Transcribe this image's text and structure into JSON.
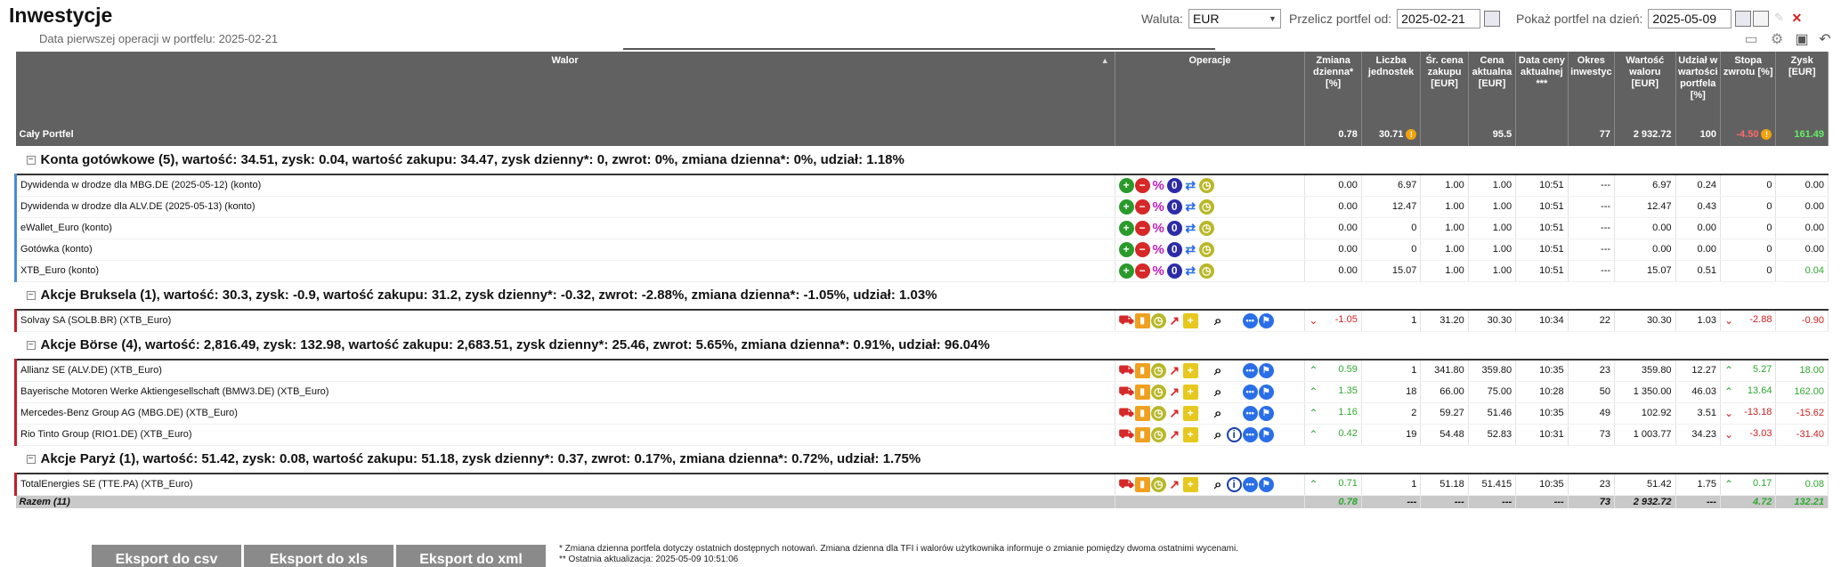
{
  "title": "Inwestycje",
  "subtitle": "Data pierwszej operacji w portfelu: 2025-02-21",
  "controls": {
    "currency_label": "Waluta:",
    "currency_value": "EUR",
    "recalc_label": "Przelicz portfel od:",
    "recalc_date": "2025-02-21",
    "show_label": "Pokaż portfel na dzień:",
    "show_date": "2025-05-09"
  },
  "table": {
    "headers": [
      "Walor",
      "Operacje",
      "Zmiana dzienna* [%]",
      "Liczba jednostek",
      "Śr. cena zakupu [EUR]",
      "Cena aktualna [EUR]",
      "Data ceny aktualnej ***",
      "Okres inwestyc",
      "Wartość waloru [EUR]",
      "Udział w wartości portfela [%]",
      "Stopa zwrotu [%]",
      "Zysk [EUR]"
    ],
    "total": {
      "name": "Cały Portfel",
      "change": "0.78",
      "units": "30.71",
      "avg": "",
      "price": "95.5",
      "date": "",
      "period": "77",
      "value": "2 932.72",
      "share": "100",
      "ret": "-4.50",
      "profit": "161.49"
    },
    "groups": [
      {
        "title": "Konta gotówkowe (5), wartość: 34.51, zysk: 0.04, wartość zakupu: 34.47, zysk dzienny*: 0, zwrot: 0%, zmiana dzienna*: 0%, udział: 1.18%",
        "kind": "cash",
        "rows": [
          {
            "name": "Dywidenda w drodze dla MBG.DE (2025-05-12) (konto)",
            "change": "0.00",
            "units": "6.97",
            "avg": "1.00",
            "price": "1.00",
            "date": "10:51",
            "period": "---",
            "value": "6.97",
            "share": "0.24",
            "ret": "0",
            "profit": "0.00"
          },
          {
            "name": "Dywidenda w drodze dla ALV.DE (2025-05-13) (konto)",
            "change": "0.00",
            "units": "12.47",
            "avg": "1.00",
            "price": "1.00",
            "date": "10:51",
            "period": "---",
            "value": "12.47",
            "share": "0.43",
            "ret": "0",
            "profit": "0.00"
          },
          {
            "name": "eWallet_Euro (konto)",
            "change": "0.00",
            "units": "0",
            "avg": "1.00",
            "price": "1.00",
            "date": "10:51",
            "period": "---",
            "value": "0.00",
            "share": "0.00",
            "ret": "0",
            "profit": "0.00"
          },
          {
            "name": "Gotówka (konto)",
            "change": "0.00",
            "units": "0",
            "avg": "1.00",
            "price": "1.00",
            "date": "10:51",
            "period": "---",
            "value": "0.00",
            "share": "0.00",
            "ret": "0",
            "profit": "0.00"
          },
          {
            "name": "XTB_Euro (konto)",
            "change": "0.00",
            "units": "15.07",
            "avg": "1.00",
            "price": "1.00",
            "date": "10:51",
            "period": "---",
            "value": "15.07",
            "share": "0.51",
            "ret": "0",
            "profit": "0.04"
          }
        ]
      },
      {
        "title": "Akcje Bruksela (1), wartość: 30.3, zysk: -0.9, wartość zakupu: 31.2, zysk dzienny*: -0.32, zwrot: -2.88%, zmiana dzienna*: -1.05%, udział: 1.03%",
        "kind": "stock",
        "rows": [
          {
            "name": "Solvay SA (SOLB.BR) (XTB_Euro)",
            "change": "-1.05",
            "units": "1",
            "avg": "31.20",
            "price": "30.30",
            "date": "10:34",
            "period": "22",
            "value": "30.30",
            "share": "1.03",
            "ret": "-2.88",
            "profit": "-0.90",
            "info": false
          }
        ]
      },
      {
        "title": "Akcje Börse (4), wartość: 2,816.49, zysk: 132.98, wartość zakupu: 2,683.51, zysk dzienny*: 25.46, zwrot: 5.65%, zmiana dzienna*: 0.91%, udział: 96.04%",
        "kind": "stock",
        "rows": [
          {
            "name": "Allianz SE (ALV.DE) (XTB_Euro)",
            "change": "0.59",
            "units": "1",
            "avg": "341.80",
            "price": "359.80",
            "date": "10:35",
            "period": "23",
            "value": "359.80",
            "share": "12.27",
            "ret": "5.27",
            "profit": "18.00",
            "info": false
          },
          {
            "name": "Bayerische Motoren Werke Aktiengesellschaft (BMW3.DE) (XTB_Euro)",
            "change": "1.35",
            "units": "18",
            "avg": "66.00",
            "price": "75.00",
            "date": "10:28",
            "period": "50",
            "value": "1 350.00",
            "share": "46.03",
            "ret": "13.64",
            "profit": "162.00",
            "info": false
          },
          {
            "name": "Mercedes-Benz Group AG (MBG.DE) (XTB_Euro)",
            "change": "1.16",
            "units": "2",
            "avg": "59.27",
            "price": "51.46",
            "date": "10:35",
            "period": "49",
            "value": "102.92",
            "share": "3.51",
            "ret": "-13.18",
            "profit": "-15.62",
            "info": false
          },
          {
            "name": "Rio Tinto Group (RIO1.DE) (XTB_Euro)",
            "change": "0.42",
            "units": "19",
            "avg": "54.48",
            "price": "52.83",
            "date": "10:31",
            "period": "73",
            "value": "1 003.77",
            "share": "34.23",
            "ret": "-3.03",
            "profit": "-31.40",
            "info": true
          }
        ]
      },
      {
        "title": "Akcje Paryż (1), wartość: 51.42, zysk: 0.08, wartość zakupu: 51.18, zysk dzienny*: 0.37, zwrot: 0.17%, zmiana dzienna*: 0.72%, udział: 1.75%",
        "kind": "stock",
        "rows": [
          {
            "name": "TotalEnergies SE (TTE.PA) (XTB_Euro)",
            "change": "0.71",
            "units": "1",
            "avg": "51.18",
            "price": "51.415",
            "date": "10:35",
            "period": "23",
            "value": "51.42",
            "share": "1.75",
            "ret": "0.17",
            "profit": "0.08",
            "info": true
          }
        ]
      }
    ],
    "sum": {
      "name": "Razem (11)",
      "change": "0.78",
      "units": "---",
      "avg": "---",
      "price": "---",
      "date": "---",
      "period": "73",
      "value": "2 932.72",
      "share": "---",
      "ret": "4.72",
      "profit": "132.21"
    }
  },
  "buttons": {
    "csv": "Eksport do csv",
    "xls": "Eksport do xls",
    "xml": "Eksport do xml"
  },
  "notes": {
    "line1": "* Zmiana dzienna portfela dotyczy ostatnich dostępnych notowań. Zmiana dzienna dla TFI i walorów użytkownika informuje o zmianie pomiędzy dwoma ostatnimi wycenami.",
    "line2": "** Ostatnia aktualizacja: 2025-05-09 10:51:06"
  },
  "colors": {
    "header_bg": "#616161",
    "negative": "#d32020",
    "positive": "#2ea82e",
    "cash_bar": "#4a8fd8",
    "stock_bar": "#c0202a"
  }
}
